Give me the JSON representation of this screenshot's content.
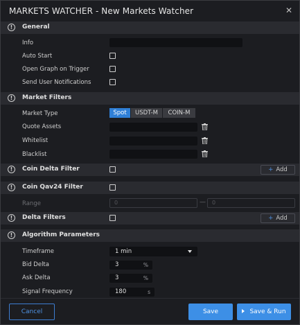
{
  "window": {
    "title": "MARKETS WATCHER - New Markets Watcher"
  },
  "sections": {
    "general": "General",
    "market_filters": "Market Filters",
    "coin_delta_filter": "Coin Delta Filter",
    "coin_qav24_filter": "Coin Qav24 Filter",
    "delta_filters": "Delta Filters",
    "algorithm_parameters": "Algorithm Parameters"
  },
  "general": {
    "info_label": "Info",
    "auto_start_label": "Auto Start",
    "open_graph_label": "Open Graph on Trigger",
    "send_notifications_label": "Send User Notifications"
  },
  "market_filters": {
    "market_type_label": "Market Type",
    "market_types": [
      "Spot",
      "USDT-M",
      "COIN-M"
    ],
    "selected_market_type": "Spot",
    "quote_assets_label": "Quote Assets",
    "whitelist_label": "Whitelist",
    "blacklist_label": "Blacklist"
  },
  "coin_delta_filter": {
    "add_label": "Add"
  },
  "coin_qav24_filter": {
    "range_label": "Range",
    "range_min_placeholder": "0",
    "range_max_placeholder": "0",
    "range_separator": "—"
  },
  "delta_filters": {
    "add_label": "Add"
  },
  "algorithm": {
    "timeframe_label": "Timeframe",
    "timeframe_value": "1 min",
    "bid_delta_label": "Bid Delta",
    "bid_delta_value": "3",
    "bid_delta_unit": "%",
    "ask_delta_label": "Ask Delta",
    "ask_delta_value": "3",
    "ask_delta_unit": "%",
    "signal_frequency_label": "Signal Frequency",
    "signal_frequency_value": "180",
    "signal_frequency_unit": "s"
  },
  "footer": {
    "cancel_label": "Cancel",
    "save_label": "Save",
    "save_run_label": "Save & Run"
  },
  "colors": {
    "background": "#1c1d21",
    "section_header": "#2a2b30",
    "input": "#101114",
    "accent": "#3d8fe6"
  },
  "icons": [
    "close-icon",
    "info-icon",
    "trash-icon",
    "plus-icon",
    "caret-down-icon",
    "play-icon"
  ]
}
